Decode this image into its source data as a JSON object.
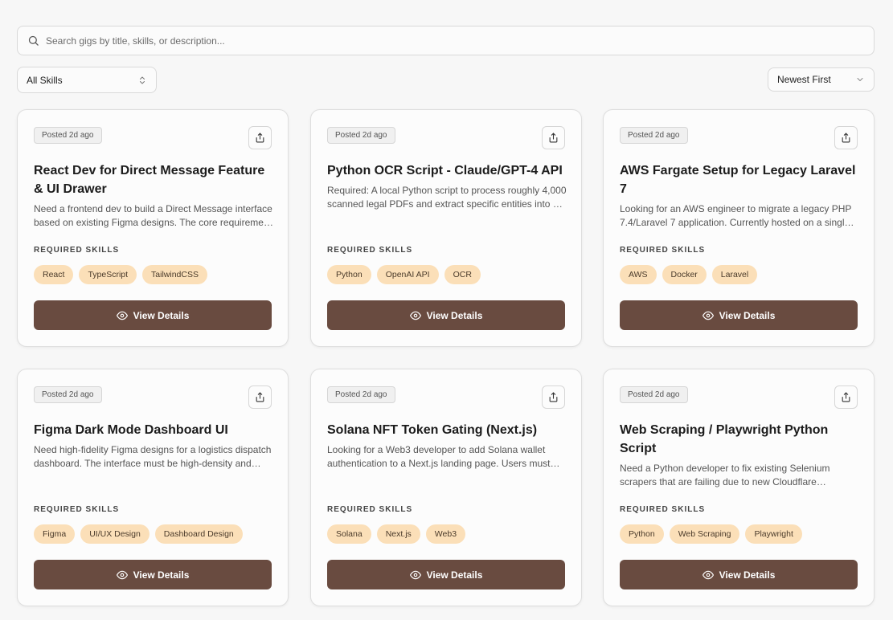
{
  "search": {
    "placeholder": "Search gigs by title, skills, or description..."
  },
  "filters": {
    "skills_value": "All Skills",
    "sort_value": "Newest First"
  },
  "colors": {
    "button": "#694b40",
    "tag_bg": "#fbdfb8",
    "tag_text": "#4a3a2a"
  },
  "labels": {
    "required_skills": "REQUIRED SKILLS",
    "view_details": "View Details"
  },
  "gigs": [
    {
      "posted": "Posted 2d ago",
      "title": "React Dev for Direct Message Feature & UI Drawer",
      "description": "Need a frontend dev to build a Direct Message interface based on existing Figma designs. The core requirement is a slide-out drawer component.",
      "skills": [
        "React",
        "TypeScript",
        "TailwindCSS"
      ]
    },
    {
      "posted": "Posted 2d ago",
      "title": "Python OCR Script - Claude/GPT-4 API",
      "description": "Required: A local Python script to process roughly 4,000 scanned legal PDFs and extract specific entities into a structured format.",
      "skills": [
        "Python",
        "OpenAI API",
        "OCR"
      ]
    },
    {
      "posted": "Posted 2d ago",
      "title": "AWS Fargate Setup for Legacy Laravel 7",
      "description": "Looking for an AWS engineer to migrate a legacy PHP 7.4/Laravel 7 application. Currently hosted on a single server.",
      "skills": [
        "AWS",
        "Docker",
        "Laravel"
      ]
    },
    {
      "posted": "Posted 2d ago",
      "title": "Figma Dark Mode Dashboard UI",
      "description": "Need high-fidelity Figma designs for a logistics dispatch dashboard. The interface must be high-density and easy to scan.",
      "skills": [
        "Figma",
        "UI/UX Design",
        "Dashboard Design"
      ]
    },
    {
      "posted": "Posted 2d ago",
      "title": "Solana NFT Token Gating (Next.js)",
      "description": "Looking for a Web3 developer to add Solana wallet authentication to a Next.js landing page. Users must hold an NFT to access content.",
      "skills": [
        "Solana",
        "Next.js",
        "Web3"
      ]
    },
    {
      "posted": "Posted 2d ago",
      "title": "Web Scraping / Playwright Python Script",
      "description": "Need a Python developer to fix existing Selenium scrapers that are failing due to new Cloudflare protections on target sites.",
      "skills": [
        "Python",
        "Web Scraping",
        "Playwright"
      ]
    }
  ]
}
